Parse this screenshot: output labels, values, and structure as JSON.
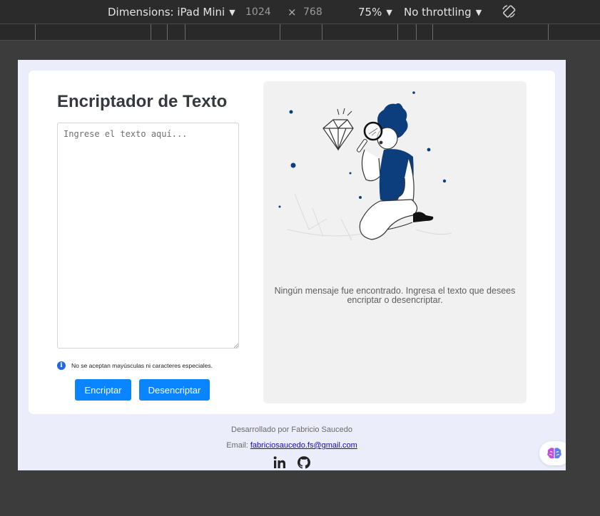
{
  "devtools": {
    "dimensions_label": "Dimensions: iPad Mini",
    "width": "1024",
    "times": "×",
    "height": "768",
    "zoom": "75%",
    "throttling": "No throttling",
    "rotate_icon": "rotate-device-icon"
  },
  "app": {
    "title": "Encriptador de Texto",
    "input": {
      "placeholder": "Ingrese el texto aquí...",
      "value": ""
    },
    "notice": {
      "icon": "info-icon",
      "text": "No se aceptan mayúsculas ni caracteres especiales."
    },
    "buttons": {
      "encrypt": "Encriptar",
      "decrypt": "Desencriptar"
    },
    "output": {
      "illustration": "person-with-magnifier-illustration",
      "message": "Ningún mensaje fue encontrado. Ingresa el texto que desees encriptar o desencriptar."
    }
  },
  "footer": {
    "credit": "Desarrollado por Fabricio Saucedo",
    "email_label": "Email: ",
    "email": "fabriciosaucedo.fs@gmail.com",
    "social_icons": [
      "linkedin-icon",
      "github-icon"
    ]
  },
  "colors": {
    "primary_button": "#0a84ff",
    "page_background": "#ebedfb",
    "title_text": "#343a40",
    "illustration_accent": "#0c3d7c"
  }
}
